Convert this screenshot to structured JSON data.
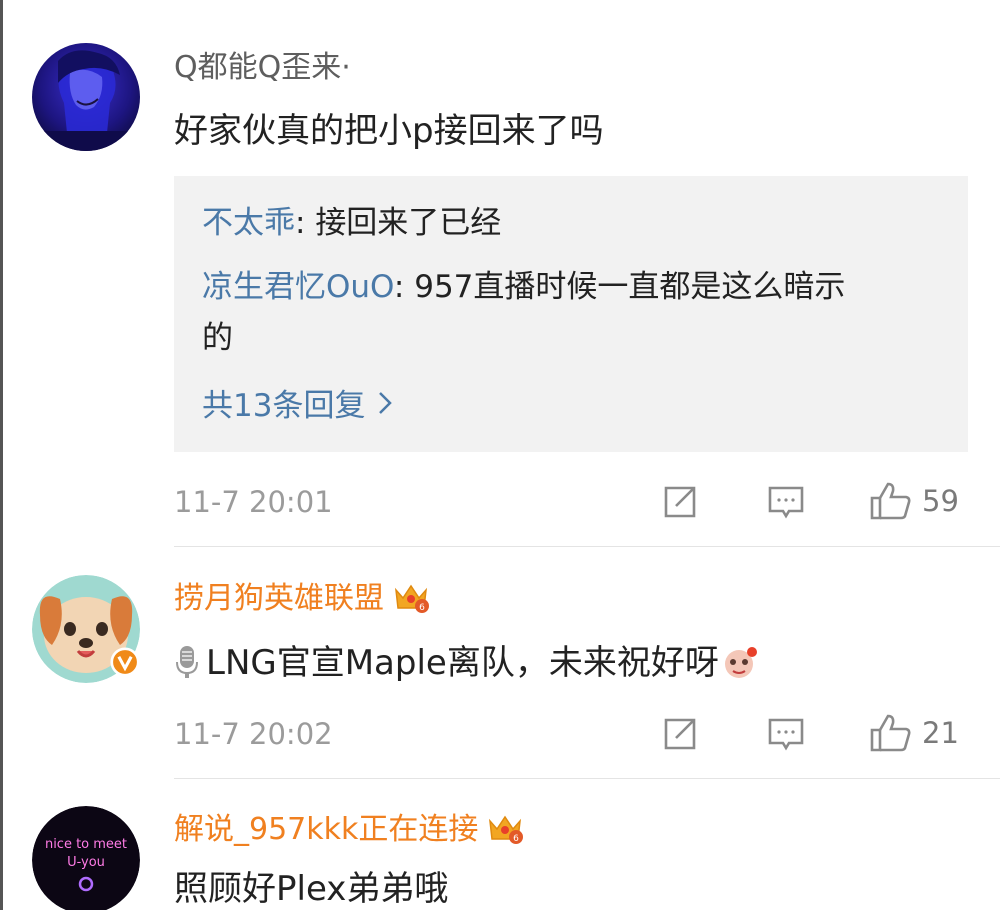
{
  "comments": [
    {
      "username": "Q都能Q歪来·",
      "content": "好家伙真的把小p接回来了吗",
      "replies": [
        {
          "user": "不太乖",
          "sep": ": ",
          "text": "接回来了已经"
        },
        {
          "user": "凉生君忆OuO",
          "sep": ": ",
          "text_line1": "957直播时候一直都是这么暗示",
          "text_line2": "的"
        }
      ],
      "more_replies": "共13条回复",
      "time": "11-7 20:01",
      "likes": "59"
    },
    {
      "username": "捞月狗英雄联盟",
      "content": "LNG官宣Maple离队，未来祝好呀",
      "time": "11-7 20:02",
      "likes": "21"
    },
    {
      "username": "解说_957kkk正在连接",
      "content": "照顾好Plex弟弟哦"
    }
  ],
  "avatar3_text": [
    "nice to meet",
    "U-you"
  ],
  "colors": {
    "vip_name": "#f08020",
    "link": "#4a79a8",
    "meta": "#9b9b9b",
    "reply_bg": "#f2f2f2"
  },
  "icons": [
    "repost-icon",
    "comment-icon",
    "like-icon",
    "vip-crown-icon",
    "verified-badge-icon",
    "mic-icon",
    "emoji-icon",
    "chevron-right-icon"
  ]
}
